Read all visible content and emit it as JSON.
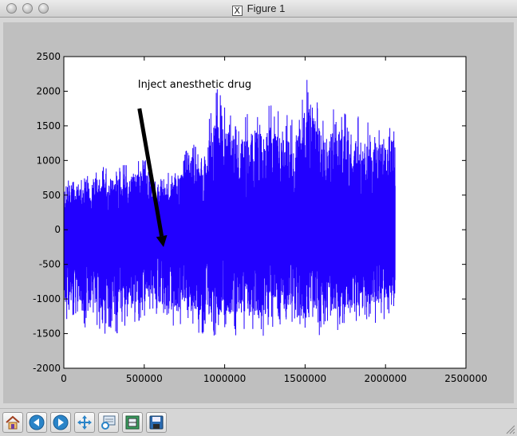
{
  "window": {
    "title": "Figure 1"
  },
  "toolbar": {
    "buttons": [
      {
        "name": "home-button",
        "icon": "home-icon"
      },
      {
        "name": "back-button",
        "icon": "arrow-left-icon"
      },
      {
        "name": "forward-button",
        "icon": "arrow-right-icon"
      },
      {
        "name": "pan-button",
        "icon": "move-icon"
      },
      {
        "name": "zoom-button",
        "icon": "zoom-rect-icon"
      },
      {
        "name": "subplots-button",
        "icon": "subplots-icon"
      },
      {
        "name": "save-button",
        "icon": "floppy-disk-icon"
      }
    ]
  },
  "chart_data": {
    "type": "line",
    "color": "#2200ff",
    "x_range_data": [
      0,
      2060000
    ],
    "envelope": [
      [
        0,
        800,
        -1300
      ],
      [
        40000,
        800,
        -1600
      ],
      [
        100000,
        700,
        -1500
      ],
      [
        200000,
        900,
        -1400
      ],
      [
        300000,
        950,
        -1600
      ],
      [
        400000,
        950,
        -1400
      ],
      [
        500000,
        1100,
        -1300
      ],
      [
        560000,
        900,
        -1200
      ],
      [
        620000,
        750,
        -1400
      ],
      [
        700000,
        950,
        -1500
      ],
      [
        780000,
        1250,
        -1450
      ],
      [
        850000,
        1300,
        -1500
      ],
      [
        900000,
        1600,
        -1550
      ],
      [
        950000,
        2100,
        -1600
      ],
      [
        1000000,
        1800,
        -1500
      ],
      [
        1100000,
        1650,
        -1550
      ],
      [
        1200000,
        1800,
        -1600
      ],
      [
        1300000,
        1800,
        -1600
      ],
      [
        1400000,
        1650,
        -1500
      ],
      [
        1450000,
        1700,
        -1550
      ],
      [
        1500000,
        2230,
        -1600
      ],
      [
        1600000,
        1800,
        -1550
      ],
      [
        1700000,
        1800,
        -1450
      ],
      [
        1800000,
        1650,
        -1400
      ],
      [
        1900000,
        1600,
        -1400
      ],
      [
        2000000,
        1600,
        -1300
      ],
      [
        2060000,
        1650,
        -1100
      ]
    ],
    "xlim": [
      0,
      2500000
    ],
    "ylim": [
      -2000,
      2500
    ],
    "xticks": [
      "0",
      "500000",
      "1000000",
      "1500000",
      "2000000",
      "2500000"
    ],
    "xtick_values": [
      0,
      500000,
      1000000,
      1500000,
      2000000,
      2500000
    ],
    "yticks": [
      "-2000",
      "-1500",
      "-1000",
      "-500",
      "0",
      "500",
      "1000",
      "1500",
      "2000",
      "2500"
    ],
    "ytick_values": [
      -2000,
      -1500,
      -1000,
      -500,
      0,
      500,
      1000,
      1500,
      2000,
      2500
    ],
    "annotation": {
      "text": "Inject anesthetic drug",
      "xytext": [
        460000,
        2050
      ],
      "xy": [
        620000,
        -250
      ],
      "arrow_tail": [
        470000,
        1750
      ]
    },
    "grid": false
  }
}
